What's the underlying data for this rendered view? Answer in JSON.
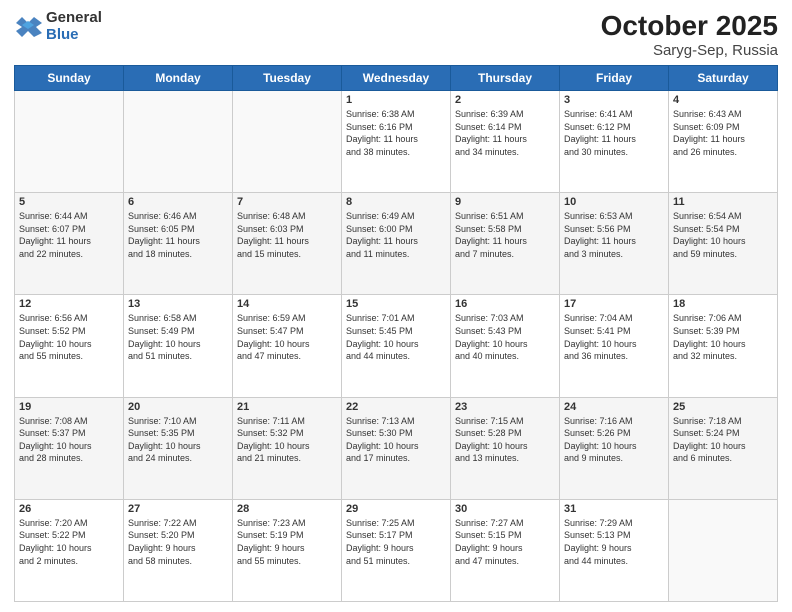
{
  "logo": {
    "general": "General",
    "blue": "Blue"
  },
  "header": {
    "title": "October 2025",
    "subtitle": "Saryg-Sep, Russia"
  },
  "weekdays": [
    "Sunday",
    "Monday",
    "Tuesday",
    "Wednesday",
    "Thursday",
    "Friday",
    "Saturday"
  ],
  "weeks": [
    [
      {
        "day": "",
        "info": ""
      },
      {
        "day": "",
        "info": ""
      },
      {
        "day": "",
        "info": ""
      },
      {
        "day": "1",
        "info": "Sunrise: 6:38 AM\nSunset: 6:16 PM\nDaylight: 11 hours\nand 38 minutes."
      },
      {
        "day": "2",
        "info": "Sunrise: 6:39 AM\nSunset: 6:14 PM\nDaylight: 11 hours\nand 34 minutes."
      },
      {
        "day": "3",
        "info": "Sunrise: 6:41 AM\nSunset: 6:12 PM\nDaylight: 11 hours\nand 30 minutes."
      },
      {
        "day": "4",
        "info": "Sunrise: 6:43 AM\nSunset: 6:09 PM\nDaylight: 11 hours\nand 26 minutes."
      }
    ],
    [
      {
        "day": "5",
        "info": "Sunrise: 6:44 AM\nSunset: 6:07 PM\nDaylight: 11 hours\nand 22 minutes."
      },
      {
        "day": "6",
        "info": "Sunrise: 6:46 AM\nSunset: 6:05 PM\nDaylight: 11 hours\nand 18 minutes."
      },
      {
        "day": "7",
        "info": "Sunrise: 6:48 AM\nSunset: 6:03 PM\nDaylight: 11 hours\nand 15 minutes."
      },
      {
        "day": "8",
        "info": "Sunrise: 6:49 AM\nSunset: 6:00 PM\nDaylight: 11 hours\nand 11 minutes."
      },
      {
        "day": "9",
        "info": "Sunrise: 6:51 AM\nSunset: 5:58 PM\nDaylight: 11 hours\nand 7 minutes."
      },
      {
        "day": "10",
        "info": "Sunrise: 6:53 AM\nSunset: 5:56 PM\nDaylight: 11 hours\nand 3 minutes."
      },
      {
        "day": "11",
        "info": "Sunrise: 6:54 AM\nSunset: 5:54 PM\nDaylight: 10 hours\nand 59 minutes."
      }
    ],
    [
      {
        "day": "12",
        "info": "Sunrise: 6:56 AM\nSunset: 5:52 PM\nDaylight: 10 hours\nand 55 minutes."
      },
      {
        "day": "13",
        "info": "Sunrise: 6:58 AM\nSunset: 5:49 PM\nDaylight: 10 hours\nand 51 minutes."
      },
      {
        "day": "14",
        "info": "Sunrise: 6:59 AM\nSunset: 5:47 PM\nDaylight: 10 hours\nand 47 minutes."
      },
      {
        "day": "15",
        "info": "Sunrise: 7:01 AM\nSunset: 5:45 PM\nDaylight: 10 hours\nand 44 minutes."
      },
      {
        "day": "16",
        "info": "Sunrise: 7:03 AM\nSunset: 5:43 PM\nDaylight: 10 hours\nand 40 minutes."
      },
      {
        "day": "17",
        "info": "Sunrise: 7:04 AM\nSunset: 5:41 PM\nDaylight: 10 hours\nand 36 minutes."
      },
      {
        "day": "18",
        "info": "Sunrise: 7:06 AM\nSunset: 5:39 PM\nDaylight: 10 hours\nand 32 minutes."
      }
    ],
    [
      {
        "day": "19",
        "info": "Sunrise: 7:08 AM\nSunset: 5:37 PM\nDaylight: 10 hours\nand 28 minutes."
      },
      {
        "day": "20",
        "info": "Sunrise: 7:10 AM\nSunset: 5:35 PM\nDaylight: 10 hours\nand 24 minutes."
      },
      {
        "day": "21",
        "info": "Sunrise: 7:11 AM\nSunset: 5:32 PM\nDaylight: 10 hours\nand 21 minutes."
      },
      {
        "day": "22",
        "info": "Sunrise: 7:13 AM\nSunset: 5:30 PM\nDaylight: 10 hours\nand 17 minutes."
      },
      {
        "day": "23",
        "info": "Sunrise: 7:15 AM\nSunset: 5:28 PM\nDaylight: 10 hours\nand 13 minutes."
      },
      {
        "day": "24",
        "info": "Sunrise: 7:16 AM\nSunset: 5:26 PM\nDaylight: 10 hours\nand 9 minutes."
      },
      {
        "day": "25",
        "info": "Sunrise: 7:18 AM\nSunset: 5:24 PM\nDaylight: 10 hours\nand 6 minutes."
      }
    ],
    [
      {
        "day": "26",
        "info": "Sunrise: 7:20 AM\nSunset: 5:22 PM\nDaylight: 10 hours\nand 2 minutes."
      },
      {
        "day": "27",
        "info": "Sunrise: 7:22 AM\nSunset: 5:20 PM\nDaylight: 9 hours\nand 58 minutes."
      },
      {
        "day": "28",
        "info": "Sunrise: 7:23 AM\nSunset: 5:19 PM\nDaylight: 9 hours\nand 55 minutes."
      },
      {
        "day": "29",
        "info": "Sunrise: 7:25 AM\nSunset: 5:17 PM\nDaylight: 9 hours\nand 51 minutes."
      },
      {
        "day": "30",
        "info": "Sunrise: 7:27 AM\nSunset: 5:15 PM\nDaylight: 9 hours\nand 47 minutes."
      },
      {
        "day": "31",
        "info": "Sunrise: 7:29 AM\nSunset: 5:13 PM\nDaylight: 9 hours\nand 44 minutes."
      },
      {
        "day": "",
        "info": ""
      }
    ]
  ]
}
